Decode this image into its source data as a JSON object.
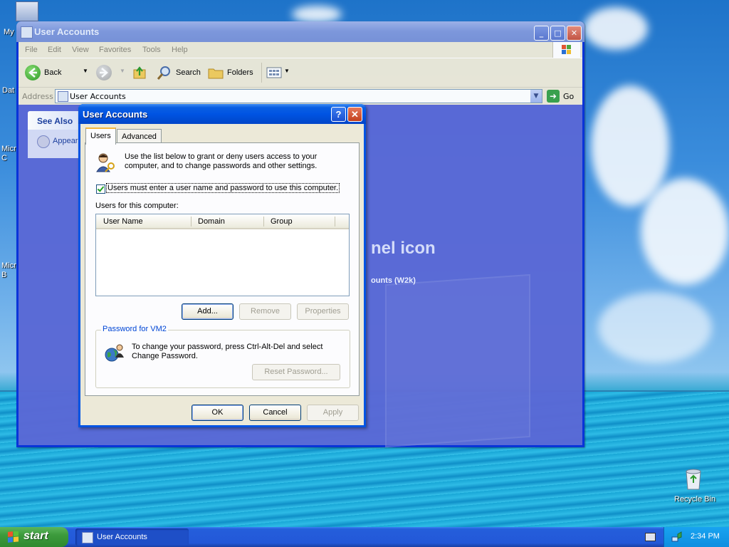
{
  "desktop": {
    "icons": [
      {
        "label": "My"
      },
      {
        "label": "Dat"
      },
      {
        "label": "Micr\nC"
      },
      {
        "label": "Micr\nB"
      },
      {
        "label": "Recycle Bin"
      }
    ]
  },
  "explorer": {
    "title": "User Accounts",
    "menu": [
      "File",
      "Edit",
      "View",
      "Favorites",
      "Tools",
      "Help"
    ],
    "toolbar": {
      "back_label": "Back",
      "search_label": "Search",
      "folders_label": "Folders"
    },
    "address": {
      "label": "Address",
      "value": "User Accounts",
      "go_label": "Go"
    },
    "see_also": {
      "heading": "See Also",
      "item": "Appear"
    },
    "background_heading": "nel icon",
    "background_sub": "ounts (W2k)"
  },
  "dialog": {
    "title": "User Accounts",
    "help_glyph": "?",
    "close_glyph": "✕",
    "tabs": [
      "Users",
      "Advanced"
    ],
    "intro_text": "Use the list below to grant or deny users access to your computer, and to change passwords and other settings.",
    "require_login_label": "Users must enter a user name and password to use this computer.",
    "require_login_checked": true,
    "users_label": "Users for this computer:",
    "columns": [
      "User Name",
      "Domain",
      "Group"
    ],
    "rows": [],
    "buttons": {
      "add": "Add...",
      "remove": "Remove",
      "properties": "Properties"
    },
    "password_group": {
      "title": "Password for VM2",
      "text": "To change your password, press Ctrl-Alt-Del and select Change Password.",
      "reset_button": "Reset Password..."
    },
    "footer": {
      "ok": "OK",
      "cancel": "Cancel",
      "apply": "Apply"
    }
  },
  "taskbar": {
    "start_label": "start",
    "task_label": "User Accounts",
    "clock": "2:34 PM"
  },
  "colors": {
    "xp_blue": "#0054e3",
    "taskbar_blue": "#245edb",
    "start_green": "#3c9a3c",
    "dialog_face": "#ece9d8"
  }
}
